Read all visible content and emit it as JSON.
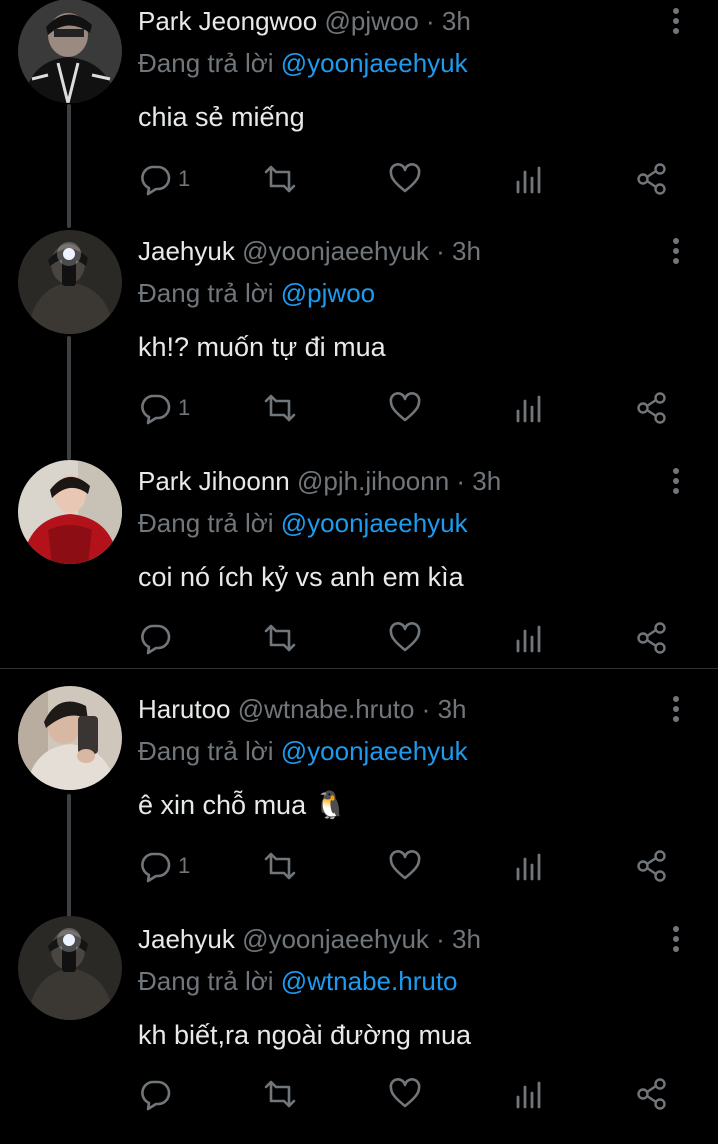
{
  "tweets": [
    {
      "name": "Park Jeongwoo",
      "handle": "@pjwoo",
      "sep": " · ",
      "time": "3h",
      "reply_prefix": "Đang trả lời ",
      "reply_to": "@yoonjaeehyuk",
      "text": "chia sẻ miếng",
      "reply_count": "1"
    },
    {
      "name": "Jaehyuk",
      "handle": "@yoonjaeehyuk",
      "sep": " · ",
      "time": "3h",
      "reply_prefix": "Đang trả lời ",
      "reply_to": "@pjwoo",
      "text": "kh!? muốn tự đi mua",
      "reply_count": "1"
    },
    {
      "name": "Park Jihoonn",
      "handle": "@pjh.jihoonn",
      "sep": " · ",
      "time": "3h",
      "reply_prefix": "Đang trả lời ",
      "reply_to": "@yoonjaeehyuk",
      "text": "coi nó ích kỷ vs anh em kìa",
      "reply_count": ""
    },
    {
      "name": "Harutoo",
      "handle": "@wtnabe.hruto",
      "sep": " · ",
      "time": "3h",
      "reply_prefix": "Đang trả lời ",
      "reply_to": "@yoonjaeehyuk",
      "text": "ê xin chỗ mua 🐧",
      "reply_count": "1"
    },
    {
      "name": "Jaehyuk",
      "handle": "@yoonjaeehyuk",
      "sep": " · ",
      "time": "3h",
      "reply_prefix": "Đang trả lời ",
      "reply_to": "@wtnabe.hruto",
      "text": "kh biết,ra ngoài đường mua",
      "reply_count": ""
    }
  ],
  "icons": {
    "reply": "reply-icon",
    "retweet": "retweet-icon",
    "like": "heart-icon",
    "views": "views-icon",
    "share": "share-icon",
    "more": "more-vertical-icon"
  },
  "colors": {
    "background": "#000000",
    "text": "#e7e9ea",
    "secondary": "#71767b",
    "accent": "#1d9bf0",
    "divider": "#2f3336"
  }
}
